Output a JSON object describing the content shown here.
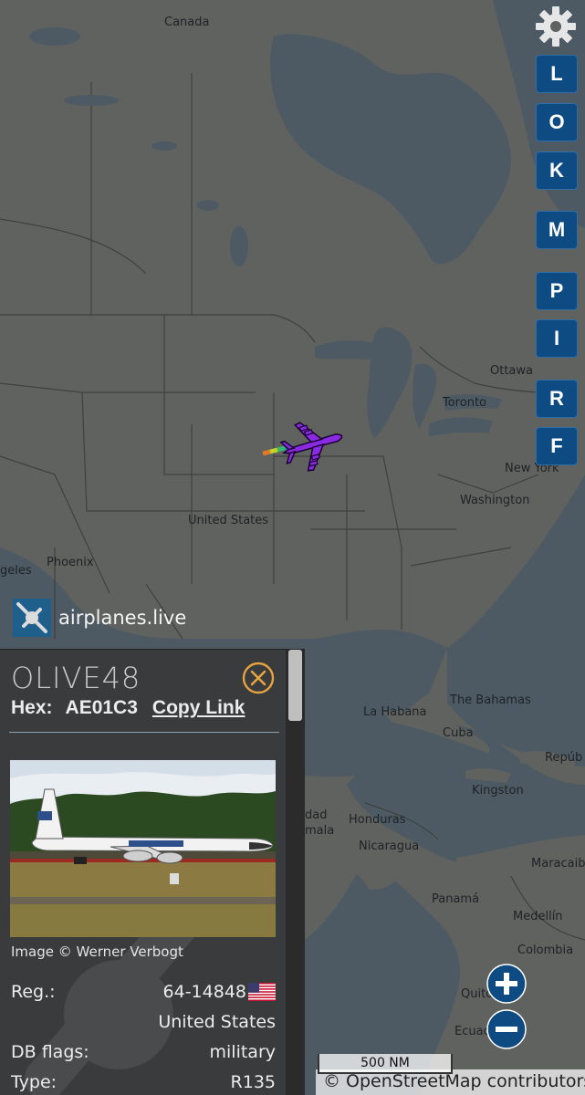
{
  "map": {
    "labels": {
      "canada": "Canada",
      "united_states": "United States",
      "ottawa": "Ottawa",
      "toronto": "Toronto",
      "new_york": "New York",
      "washington": "Washington",
      "phoenix": "Phoenix",
      "angeles": "geles",
      "la_habana": "La Habana",
      "bahamas": "The Bahamas",
      "cuba": "Cuba",
      "kingston": "Kingston",
      "honduras": "Honduras",
      "nicaragua": "Nicaragua",
      "panama": "Panamá",
      "medellin": "Medellín",
      "colombia": "Colombia",
      "maracaibo": "Maracaibo",
      "quito": "Quito",
      "ecuador": "Ecuador",
      "repub": "Repúb",
      "dad": "dad",
      "mala": "mala"
    },
    "scale": "500 NM",
    "attribution": "© OpenStreetMap contributors."
  },
  "toolbar": {
    "buttons": [
      "L",
      "O",
      "K",
      "M",
      "P",
      "I",
      "R",
      "F"
    ]
  },
  "brand": {
    "name": "airplanes.live"
  },
  "aircraft": {
    "callsign": "OLIVE48",
    "hex_label": "Hex:",
    "hex": "AE01C3",
    "copy_link": "Copy Link",
    "photo_credit": "Image © Werner Verbogt",
    "reg_label": "Reg.:",
    "reg": "64-14848",
    "country": "United States",
    "db_flags_label": "DB flags:",
    "db_flags": "military",
    "type_label": "Type:",
    "type": "R135"
  },
  "icons": {
    "gear": "gear-icon",
    "close": "close-circle-icon",
    "zoom_in": "plus-icon",
    "zoom_out": "minus-icon",
    "flag": "us-flag-icon",
    "aircraft": "aircraft-icon"
  },
  "colors": {
    "map_land": "#5f625e",
    "map_water": "#4d5a64",
    "button_blue": "#0d4b82",
    "aircraft_purple": "#8a2be2",
    "panel_bg": "#3a3b3c"
  }
}
